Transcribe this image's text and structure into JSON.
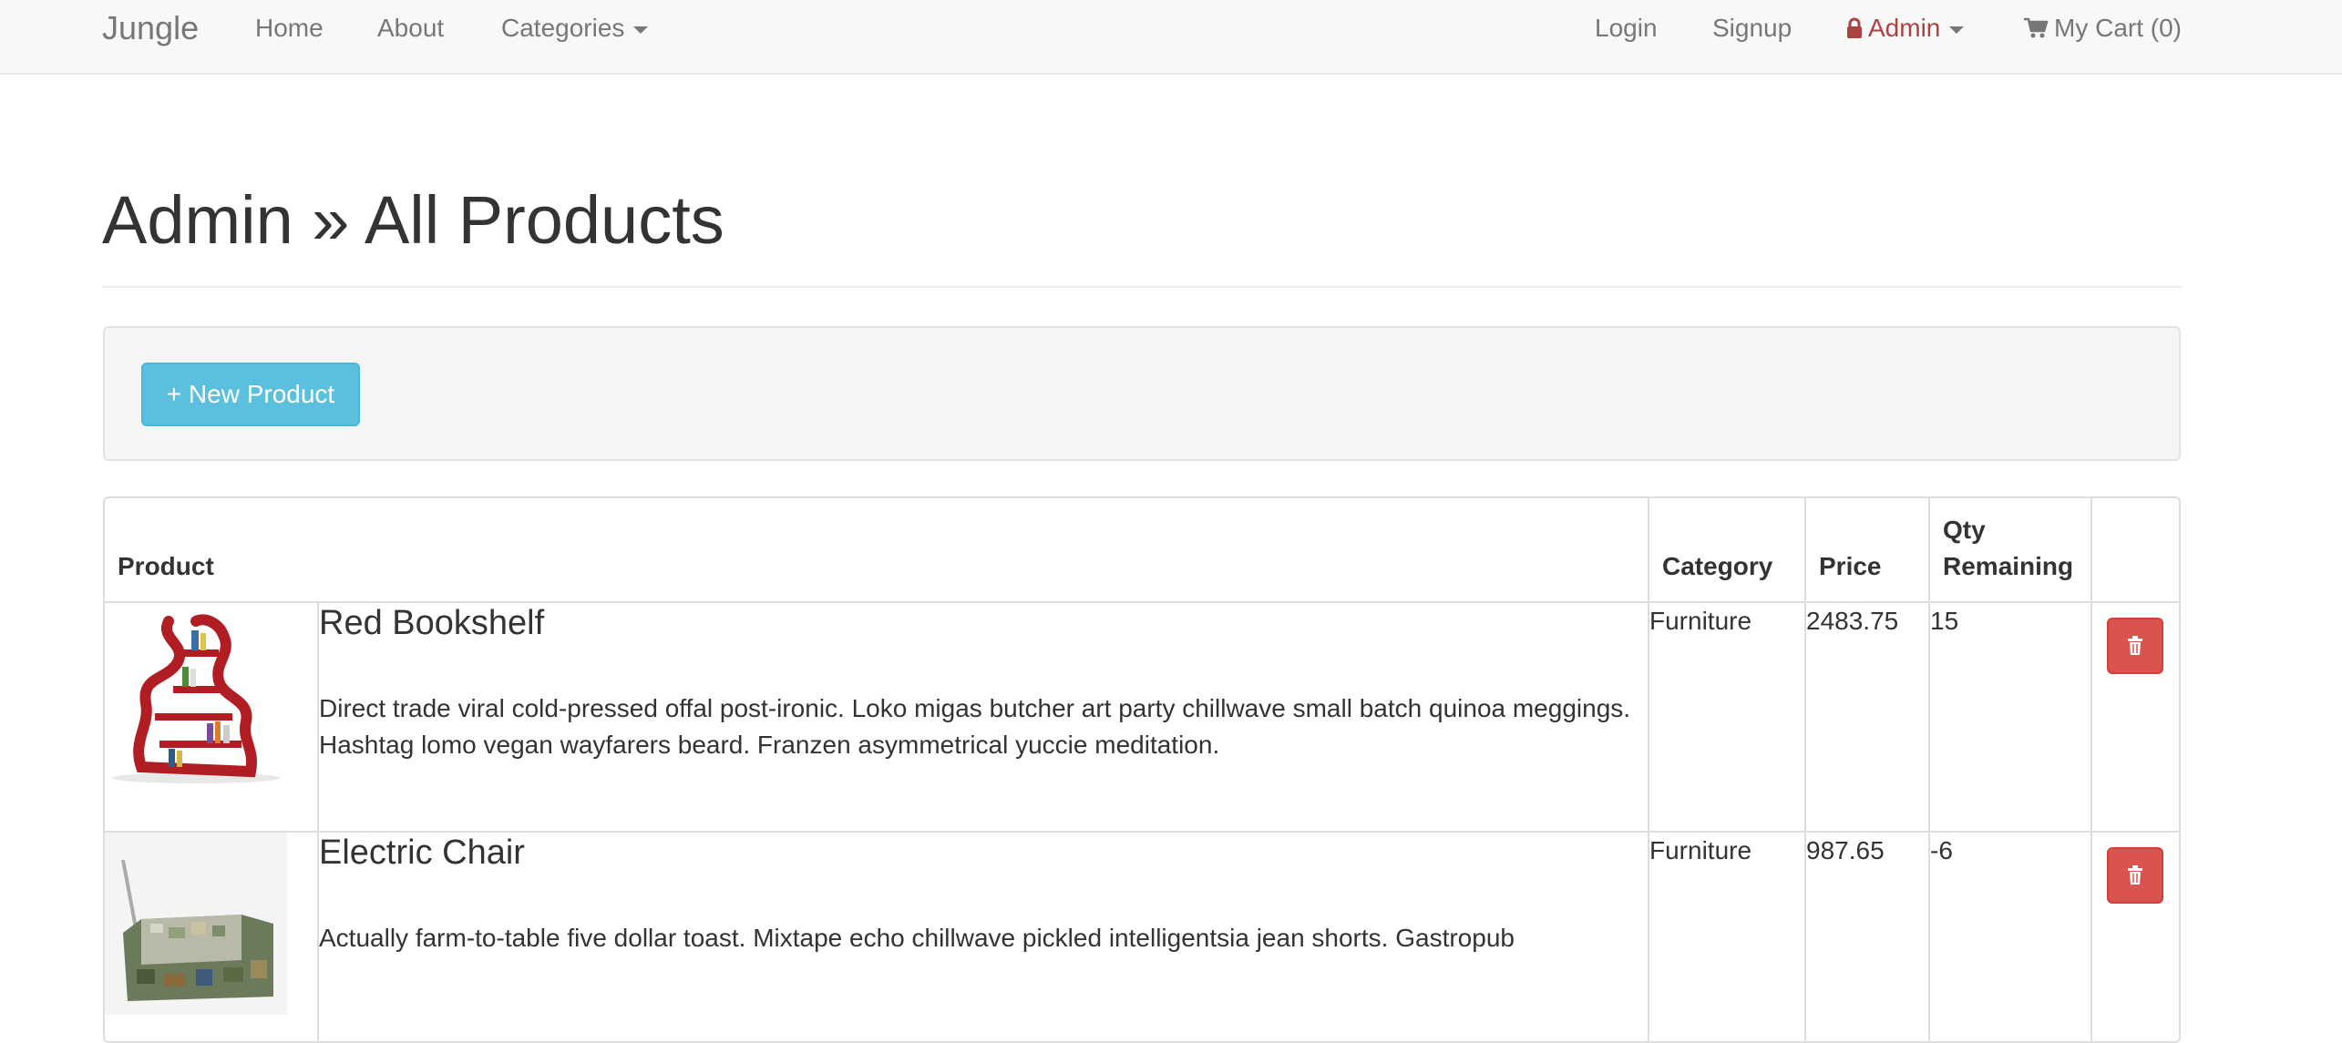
{
  "navbar": {
    "brand": "Jungle",
    "home": "Home",
    "about": "About",
    "categories": "Categories",
    "login": "Login",
    "signup": "Signup",
    "admin": "Admin",
    "cart": "My Cart (0)"
  },
  "page": {
    "title": "Admin » All Products",
    "new_product_label": "+ New Product"
  },
  "table": {
    "headers": {
      "product": "Product",
      "category": "Category",
      "price": "Price",
      "qty": "Qty Remaining"
    },
    "rows": [
      {
        "name": "Red Bookshelf",
        "description": "Direct trade viral cold-pressed offal post-ironic. Loko migas butcher art party chillwave small batch quinoa meggings. Hashtag lomo vegan wayfarers beard. Franzen asymmetrical yuccie meditation.",
        "category": "Furniture",
        "price": "2483.75",
        "qty": "15"
      },
      {
        "name": "Electric Chair",
        "description": "Actually farm-to-table five dollar toast. Mixtape echo chillwave pickled intelligentsia jean shorts. Gastropub",
        "category": "Furniture",
        "price": "987.65",
        "qty": "-6"
      }
    ]
  },
  "colors": {
    "navbar_bg": "#f8f8f8",
    "admin_link": "#a94442",
    "info_button": "#5bc0de",
    "danger_button": "#d9534f"
  },
  "icons": {
    "admin": "lock-icon",
    "cart": "shopping-cart-icon",
    "delete": "trash-icon",
    "dropdown": "chevron-down-icon"
  }
}
